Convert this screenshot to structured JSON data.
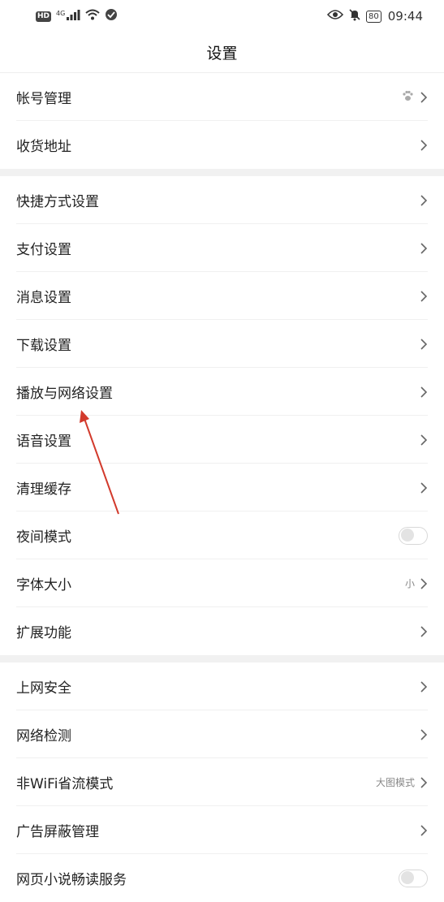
{
  "status_bar": {
    "hd": "HD",
    "network": "4G",
    "battery": "80",
    "time": "09:44"
  },
  "header": {
    "title": "设置"
  },
  "groups": [
    {
      "items": [
        {
          "label": "帐号管理",
          "icon": "paw-icon"
        },
        {
          "label": "收货地址"
        }
      ]
    },
    {
      "items": [
        {
          "label": "快捷方式设置"
        },
        {
          "label": "支付设置"
        },
        {
          "label": "消息设置"
        },
        {
          "label": "下载设置"
        },
        {
          "label": "播放与网络设置"
        },
        {
          "label": "语音设置"
        },
        {
          "label": "清理缓存"
        },
        {
          "label": "夜间模式",
          "toggle": false
        },
        {
          "label": "字体大小",
          "value": "小"
        },
        {
          "label": "扩展功能"
        }
      ]
    },
    {
      "items": [
        {
          "label": "上网安全"
        },
        {
          "label": "网络检测"
        },
        {
          "label": "非WiFi省流模式",
          "value": "大图模式"
        },
        {
          "label": "广告屏蔽管理"
        },
        {
          "label": "网页小说畅读服务",
          "toggle": false
        }
      ]
    }
  ],
  "colors": {
    "annotation_arrow": "#d23a2c",
    "separator": "#f1f1f1"
  }
}
